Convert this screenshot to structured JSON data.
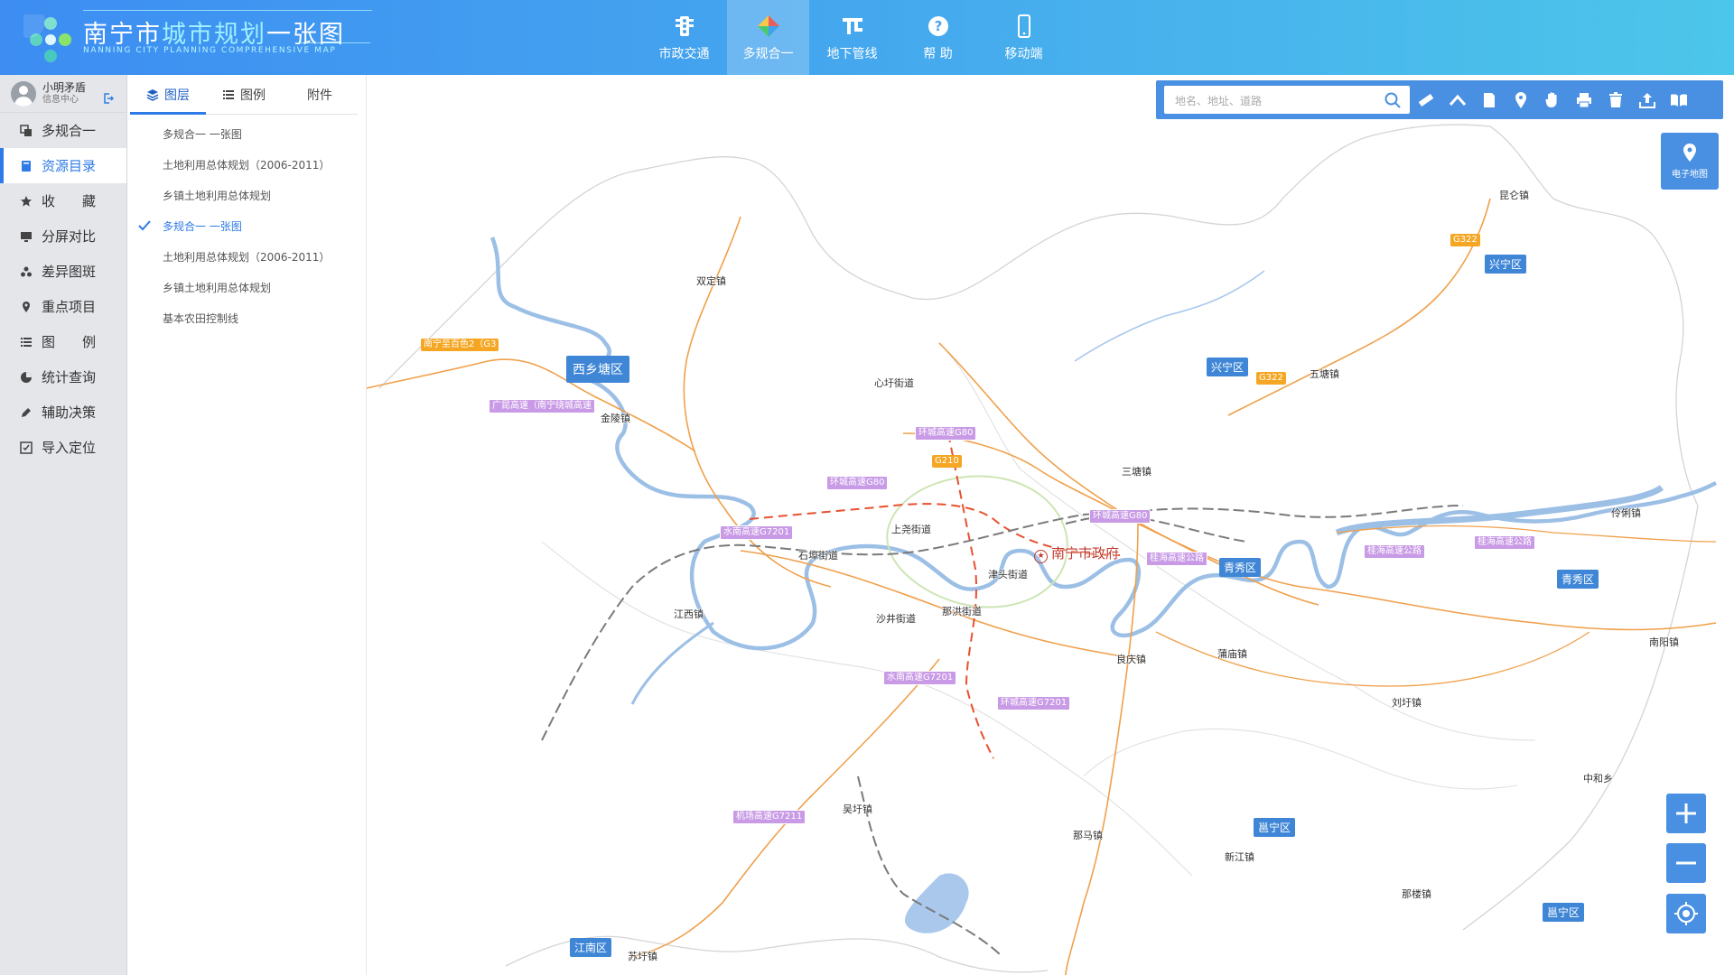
{
  "header": {
    "title_prefix": "南宁市",
    "title_highlight": "城市规划",
    "title_suffix": "一张图",
    "subtitle": "NANNING CITY PLANNING COMPREHENSIVE MAP",
    "nav": [
      {
        "label": "市政交通",
        "icon": "traffic-light-icon"
      },
      {
        "label": "多规合一",
        "icon": "diamond-layers-icon",
        "active": true
      },
      {
        "label": "地下管线",
        "icon": "pipeline-icon"
      },
      {
        "label": "帮 助",
        "icon": "help-icon"
      },
      {
        "label": "移动端",
        "icon": "mobile-icon"
      }
    ]
  },
  "user": {
    "name": "小明矛盾",
    "center": "信息中心"
  },
  "menu": [
    {
      "label": "多规合一",
      "icon": "copy-icon"
    },
    {
      "label": "资源目录",
      "icon": "book-icon",
      "active": true
    },
    {
      "label": "收　　藏",
      "icon": "star-icon"
    },
    {
      "label": "分屏对比",
      "icon": "monitor-icon"
    },
    {
      "label": "差异图斑",
      "icon": "dots-icon"
    },
    {
      "label": "重点项目",
      "icon": "pin-icon"
    },
    {
      "label": "图　　例",
      "icon": "list-icon"
    },
    {
      "label": "统计查询",
      "icon": "pie-icon"
    },
    {
      "label": "辅助决策",
      "icon": "pen-icon"
    },
    {
      "label": "导入定位",
      "icon": "import-icon"
    }
  ],
  "panel": {
    "tabs": [
      {
        "label": "图层",
        "active": true
      },
      {
        "label": "图例"
      },
      {
        "label": "附件"
      }
    ],
    "layers": [
      {
        "label": "多规合一 一张图"
      },
      {
        "label": "土地利用总体规划（2006-2011）"
      },
      {
        "label": "乡镇土地利用总体规划"
      },
      {
        "label": "多规合一 一张图",
        "checked": true
      },
      {
        "label": "土地利用总体规划（2006-2011）"
      },
      {
        "label": "乡镇土地利用总体规划"
      },
      {
        "label": "基本农田控制线"
      }
    ]
  },
  "map": {
    "search_placeholder": "地名、地址、道路",
    "basemap_label": "电子地图",
    "government": "南宁市政府",
    "towns": [
      "昆仑镇",
      "五塘镇",
      "双定镇",
      "金陵镇",
      "心圩街道",
      "三塘镇",
      "上尧街道",
      "石埠街道",
      "津头街道",
      "伶俐镇",
      "江西镇",
      "沙井街道",
      "那洪街道",
      "良庆镇",
      "蒲庙镇",
      "南阳镇",
      "刘圩镇",
      "中和乡",
      "吴圩镇",
      "那马镇",
      "新江镇",
      "那楼镇",
      "苏圩镇"
    ],
    "districts": [
      "兴宁区",
      "西乡塘区",
      "兴宁区",
      "青秀区",
      "青秀区",
      "邕宁区",
      "邕宁区",
      "江南区"
    ],
    "roads": [
      "G322",
      "南宁至百色2（G3",
      "广昆高速（南宁绕城高速",
      "环城高速G80",
      "G210",
      "环城高速G80",
      "水南高速G7201",
      "环城高速G80",
      "G322",
      "桂海高速公路",
      "桂海高速公路",
      "桂海高速公路",
      "水南高速G7201",
      "环城高速G7201",
      "机场高速G7211"
    ]
  },
  "colors": {
    "accent": "#2e7ae6",
    "header_start": "#3d8df2",
    "header_end": "#4cc6ea",
    "toolbar": "#4a90e2",
    "river": "#9cbfe6",
    "highway": "#f0a04b"
  }
}
